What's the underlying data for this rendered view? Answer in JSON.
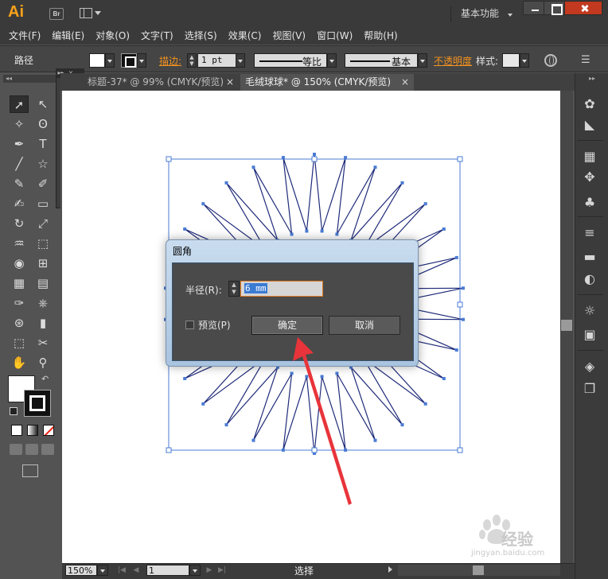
{
  "app": {
    "logo": "Ai",
    "bridge_label": "Br",
    "workspace_label": "基本功能",
    "colors": {
      "accent": "#f7a21b",
      "link_orange": "#f4931f",
      "selection_blue": "#3b7bd3",
      "path_blue": "#1f2b7a"
    }
  },
  "menu": [
    "文件(F)",
    "编辑(E)",
    "对象(O)",
    "文字(T)",
    "选择(S)",
    "效果(C)",
    "视图(V)",
    "窗口(W)",
    "帮助(H)"
  ],
  "control": {
    "selection_label": "路径",
    "stroke_label": "描边:",
    "stroke_weight": "1 pt",
    "variable_width": "等比",
    "brush": "基本",
    "opacity_label": "不透明度",
    "style_label": "样式:"
  },
  "tabs": [
    {
      "label": "标题-37* @ 99% (CMYK/预览)",
      "close": "×"
    },
    {
      "label": "毛绒球球* @ 150% (CMYK/预览)",
      "close": "×"
    }
  ],
  "toolbox_icons": [
    "selection-icon",
    "direct-selection-icon",
    "magic-wand-icon",
    "lasso-icon",
    "pen-icon",
    "type-icon",
    "line-icon",
    "star-icon",
    "paintbrush-icon",
    "pencil-icon",
    "blob-brush-icon",
    "eraser-icon",
    "rotate-icon",
    "scale-icon",
    "warp-icon",
    "free-transform-icon",
    "shape-builder-icon",
    "perspective-icon",
    "mesh-icon",
    "gradient-icon",
    "eyedropper-icon",
    "blend-icon",
    "symbol-sprayer-icon",
    "column-graph-icon",
    "artboard-icon",
    "slice-icon",
    "hand-icon",
    "zoom-icon"
  ],
  "dialog": {
    "title": "圆角",
    "radius_label": "半径(R):",
    "radius_value": "6 mm",
    "preview_label": "预览(P)",
    "preview_checked": false,
    "ok_label": "确定",
    "cancel_label": "取消"
  },
  "status": {
    "zoom": "150%",
    "page": "1",
    "tool": "选择"
  },
  "watermark": {
    "text": "经验",
    "url": "jingyan.baidu.com"
  }
}
